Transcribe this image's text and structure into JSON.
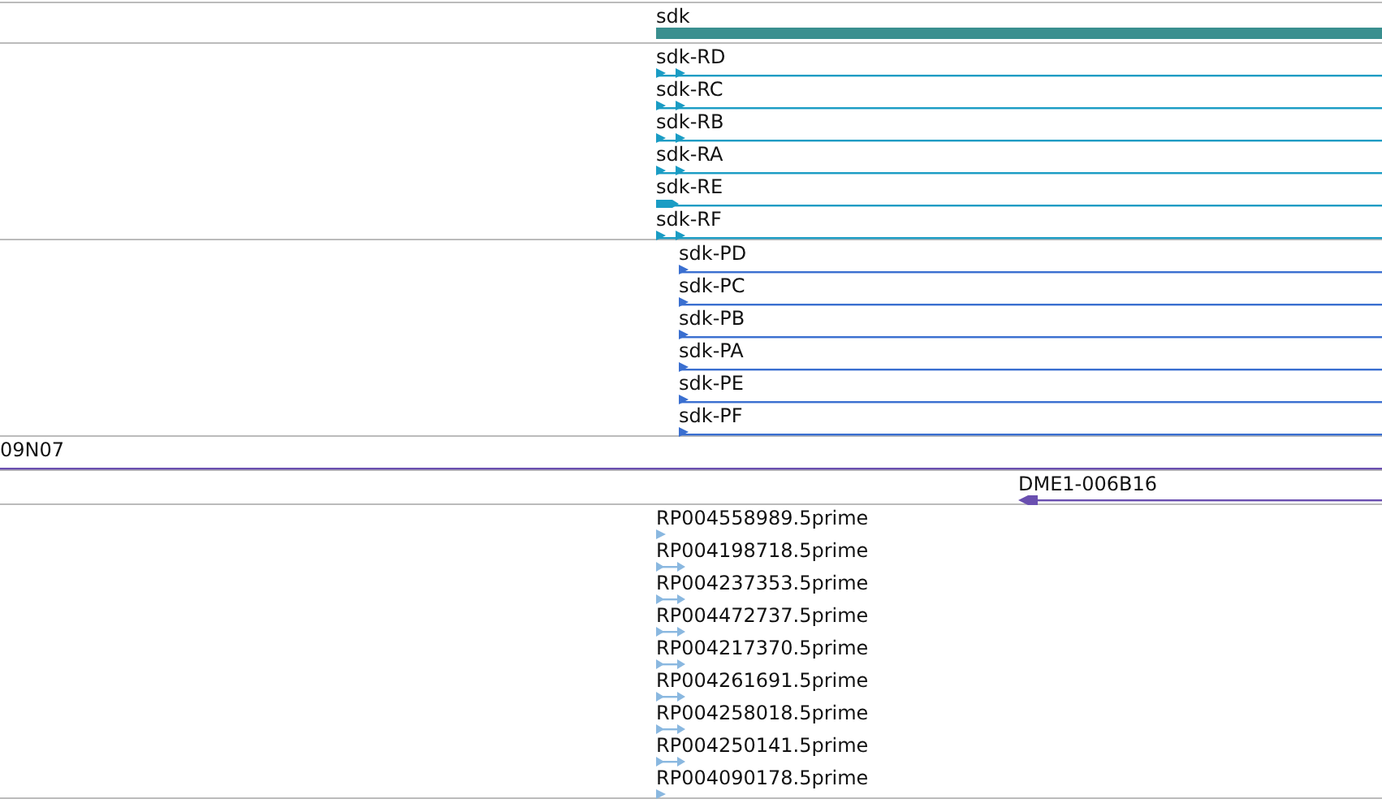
{
  "tracks": [
    {
      "kind": "gene",
      "color": "#3a8f8f",
      "features": [
        {
          "label": "sdk",
          "kind": "bar"
        }
      ]
    },
    {
      "kind": "transcript",
      "color": "#1a9cc4",
      "features": [
        {
          "label": "sdk-RD",
          "kind": "double"
        },
        {
          "label": "sdk-RC",
          "kind": "double"
        },
        {
          "label": "sdk-RB",
          "kind": "double"
        },
        {
          "label": "sdk-RA",
          "kind": "double"
        },
        {
          "label": "sdk-RE",
          "kind": "thick"
        },
        {
          "label": "sdk-RF",
          "kind": "double"
        }
      ]
    },
    {
      "kind": "protein",
      "color": "#3a6fd0",
      "features": [
        {
          "label": "sdk-PD",
          "kind": "single"
        },
        {
          "label": "sdk-PC",
          "kind": "single"
        },
        {
          "label": "sdk-PB",
          "kind": "single"
        },
        {
          "label": "sdk-PA",
          "kind": "single"
        },
        {
          "label": "sdk-PE",
          "kind": "single"
        },
        {
          "label": "sdk-PF",
          "kind": "single"
        }
      ]
    },
    {
      "kind": "clone",
      "color": "#6a4fb0",
      "features": [
        {
          "label": "09N07",
          "kind": "line"
        }
      ]
    },
    {
      "kind": "clone-end",
      "color": "#6a4fb0",
      "features": [
        {
          "label": "DME1-006B16",
          "kind": "reverse"
        }
      ]
    },
    {
      "kind": "read",
      "color": "#8ab8e0",
      "features": [
        {
          "label": "RP004558989.5prime",
          "kind": "tick"
        },
        {
          "label": "RP004198718.5prime",
          "kind": "pair"
        },
        {
          "label": "RP004237353.5prime",
          "kind": "pair"
        },
        {
          "label": "RP004472737.5prime",
          "kind": "pair"
        },
        {
          "label": "RP004217370.5prime",
          "kind": "pair"
        },
        {
          "label": "RP004261691.5prime",
          "kind": "pair"
        },
        {
          "label": "RP004258018.5prime",
          "kind": "pair"
        },
        {
          "label": "RP004250141.5prime",
          "kind": "pair"
        },
        {
          "label": "RP004090178.5prime",
          "kind": "tick"
        }
      ]
    }
  ]
}
